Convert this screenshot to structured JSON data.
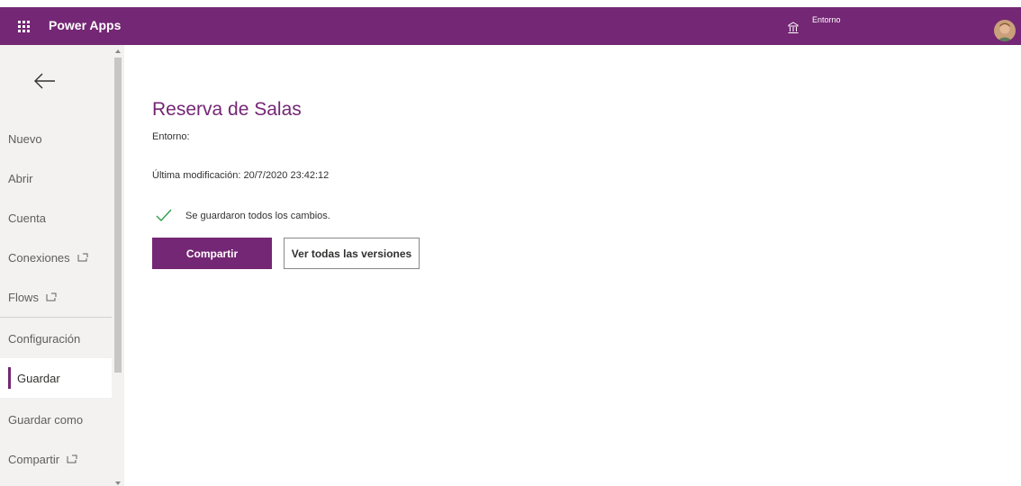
{
  "app": {
    "title": "Power Apps",
    "environment_label": "Entorno",
    "accent_color": "#742774"
  },
  "sidebar": {
    "items": [
      {
        "label": "Nuevo",
        "external": false
      },
      {
        "label": "Abrir",
        "external": false
      },
      {
        "label": "Cuenta",
        "external": false
      },
      {
        "label": "Conexiones",
        "external": true
      },
      {
        "label": "Flows",
        "external": true
      },
      {
        "label": "Configuración",
        "external": false
      },
      {
        "label": "Guardar",
        "external": false,
        "active": true
      },
      {
        "label": "Guardar como",
        "external": false
      },
      {
        "label": "Compartir",
        "external": true
      }
    ]
  },
  "main": {
    "title": "Reserva de Salas",
    "environment": "Entorno:",
    "last_modified": "Última modificación: 20/7/2020 23:42:12",
    "saved_message": "Se guardaron todos los cambios.",
    "share_button": "Compartir",
    "versions_button": "Ver todas las versiones"
  }
}
